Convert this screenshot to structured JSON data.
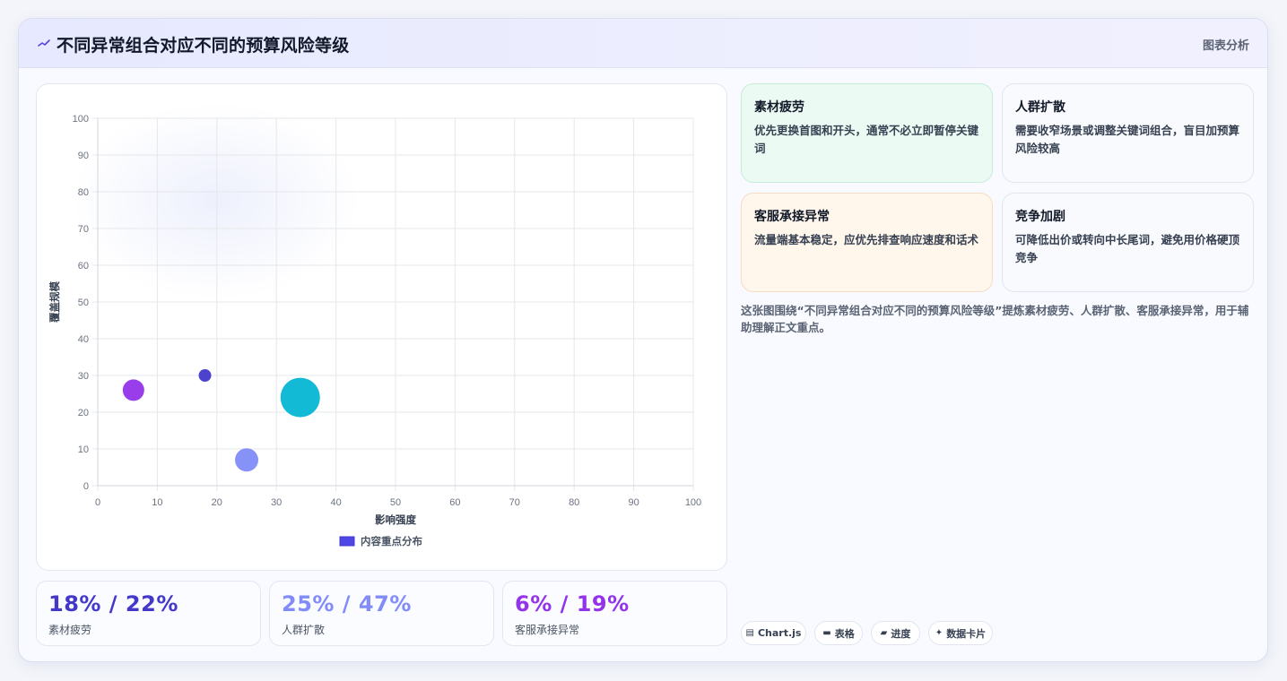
{
  "header": {
    "title": "不同异常组合对应不同的预算风险等级",
    "tag": "图表分析"
  },
  "chart_data": {
    "type": "scatter",
    "subtype": "bubble",
    "xlabel": "影响强度",
    "ylabel": "覆盖规模",
    "xlim": [
      0,
      100
    ],
    "ylim": [
      0,
      100
    ],
    "xticks": [
      0,
      10,
      20,
      30,
      40,
      50,
      60,
      70,
      80,
      90,
      100
    ],
    "yticks": [
      0,
      10,
      20,
      30,
      40,
      50,
      60,
      70,
      80,
      90,
      100
    ],
    "grid": true,
    "legend": {
      "position": "bottom",
      "label": "内容重点分布",
      "color": "#4f46e5"
    },
    "series": [
      {
        "name": "内容重点分布",
        "points": [
          {
            "x": 18,
            "y": 30,
            "r": 7,
            "color": "#4338ca"
          },
          {
            "x": 25,
            "y": 7,
            "r": 13,
            "color": "#818cf8"
          },
          {
            "x": 6,
            "y": 26,
            "r": 12,
            "color": "#9333ea"
          },
          {
            "x": 34,
            "y": 24,
            "r": 22,
            "color": "#06b6d4"
          }
        ]
      }
    ]
  },
  "stats": [
    {
      "value": "18% / 22%",
      "label": "素材疲劳",
      "color": "#4338ca"
    },
    {
      "value": "25% / 47%",
      "label": "人群扩散",
      "color": "#818cf8"
    },
    {
      "value": "6% / 19%",
      "label": "客服承接异常",
      "color": "#9333ea"
    }
  ],
  "cards": [
    {
      "title": "素材疲劳",
      "desc": "优先更换首图和开头，通常不必立即暂停关键词"
    },
    {
      "title": "人群扩散",
      "desc": "需要收窄场景或调整关键词组合，盲目加预算风险较高"
    },
    {
      "title": "客服承接异常",
      "desc": "流量端基本稳定，应优先排查响应速度和话术"
    },
    {
      "title": "竞争加剧",
      "desc": "可降低出价或转向中长尾词，避免用价格硬顶竞争"
    }
  ],
  "summary": "这张图围绕“不同异常组合对应不同的预算风险等级”提炼素材疲劳、人群扩散、客服承接异常，用于辅助理解正文重点。",
  "tags": [
    {
      "icon": "chart-icon",
      "label": "Chart.js"
    },
    {
      "icon": "table-icon",
      "label": "表格"
    },
    {
      "icon": "progress-icon",
      "label": "进度"
    },
    {
      "icon": "sparkle-icon",
      "label": "数据卡片"
    }
  ]
}
